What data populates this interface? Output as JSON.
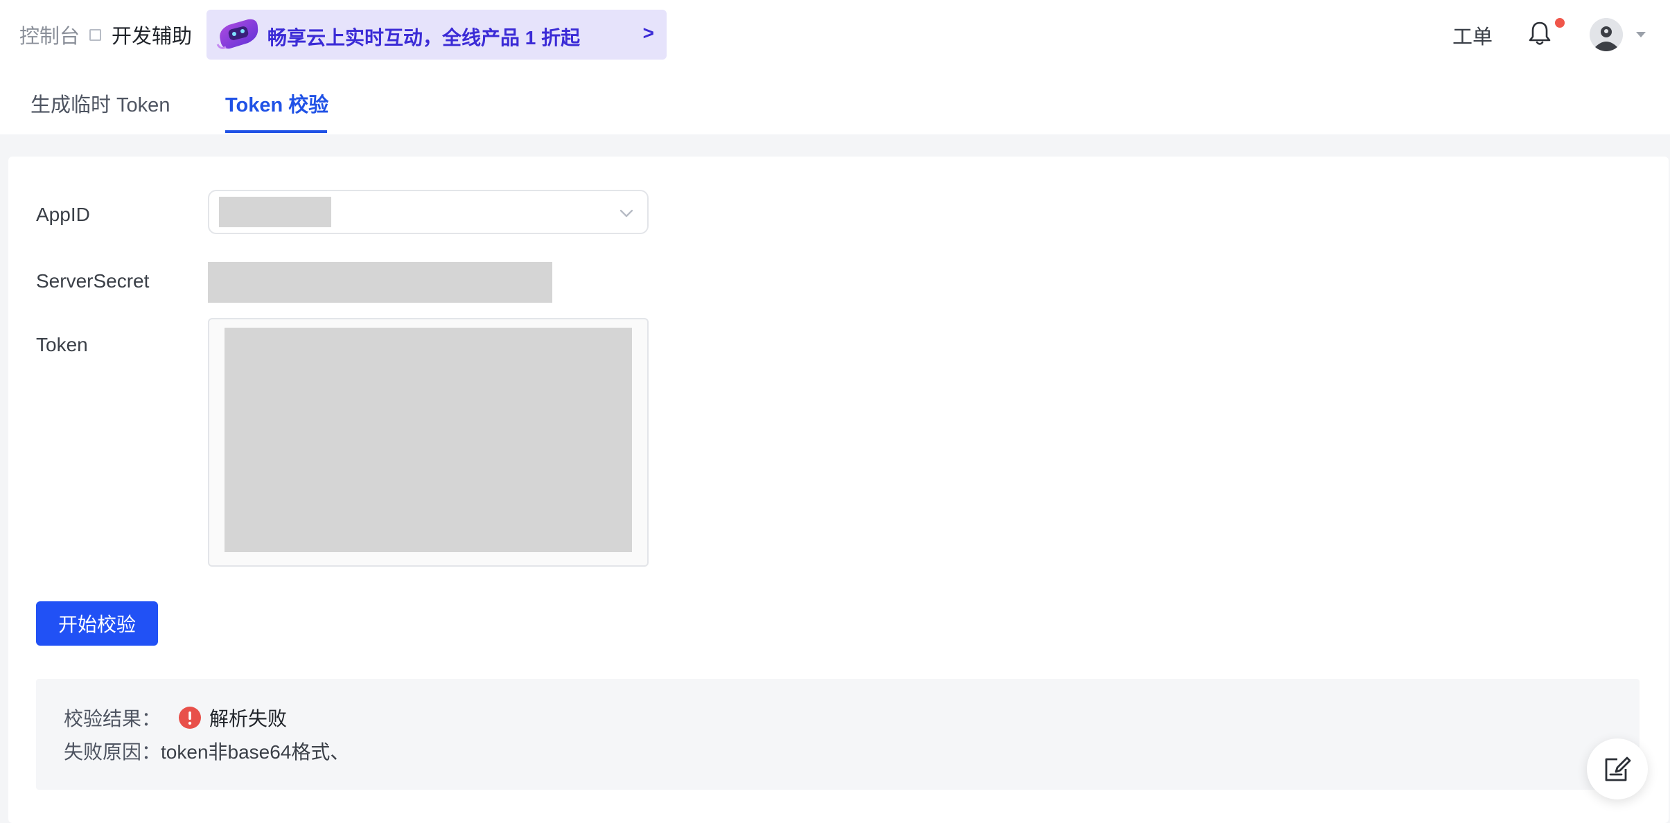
{
  "header": {
    "breadcrumb_root": "控制台",
    "breadcrumb_current": "开发辅助",
    "promo_text": "畅享云上实时互动，全线产品 1 折起",
    "promo_arrow": ">",
    "ticket_label": "工单",
    "notification_dot": true
  },
  "tabs": [
    {
      "label": "生成临时 Token",
      "active": false
    },
    {
      "label": "Token 校验",
      "active": true
    }
  ],
  "form": {
    "appid_label": "AppID",
    "serversecret_label": "ServerSecret",
    "token_label": "Token",
    "submit_label": "开始校验"
  },
  "result": {
    "status_key": "校验结果：",
    "status_text": "解析失败",
    "status_icon": "error-circle-icon",
    "reason_key": "失败原因：",
    "reason_text": "token非base64格式、"
  },
  "colors": {
    "accent": "#2052e6",
    "button": "#2151f5",
    "promo_bg": "#e6e3fb",
    "promo_text": "#3b2bd6",
    "error": "#e8504a"
  }
}
